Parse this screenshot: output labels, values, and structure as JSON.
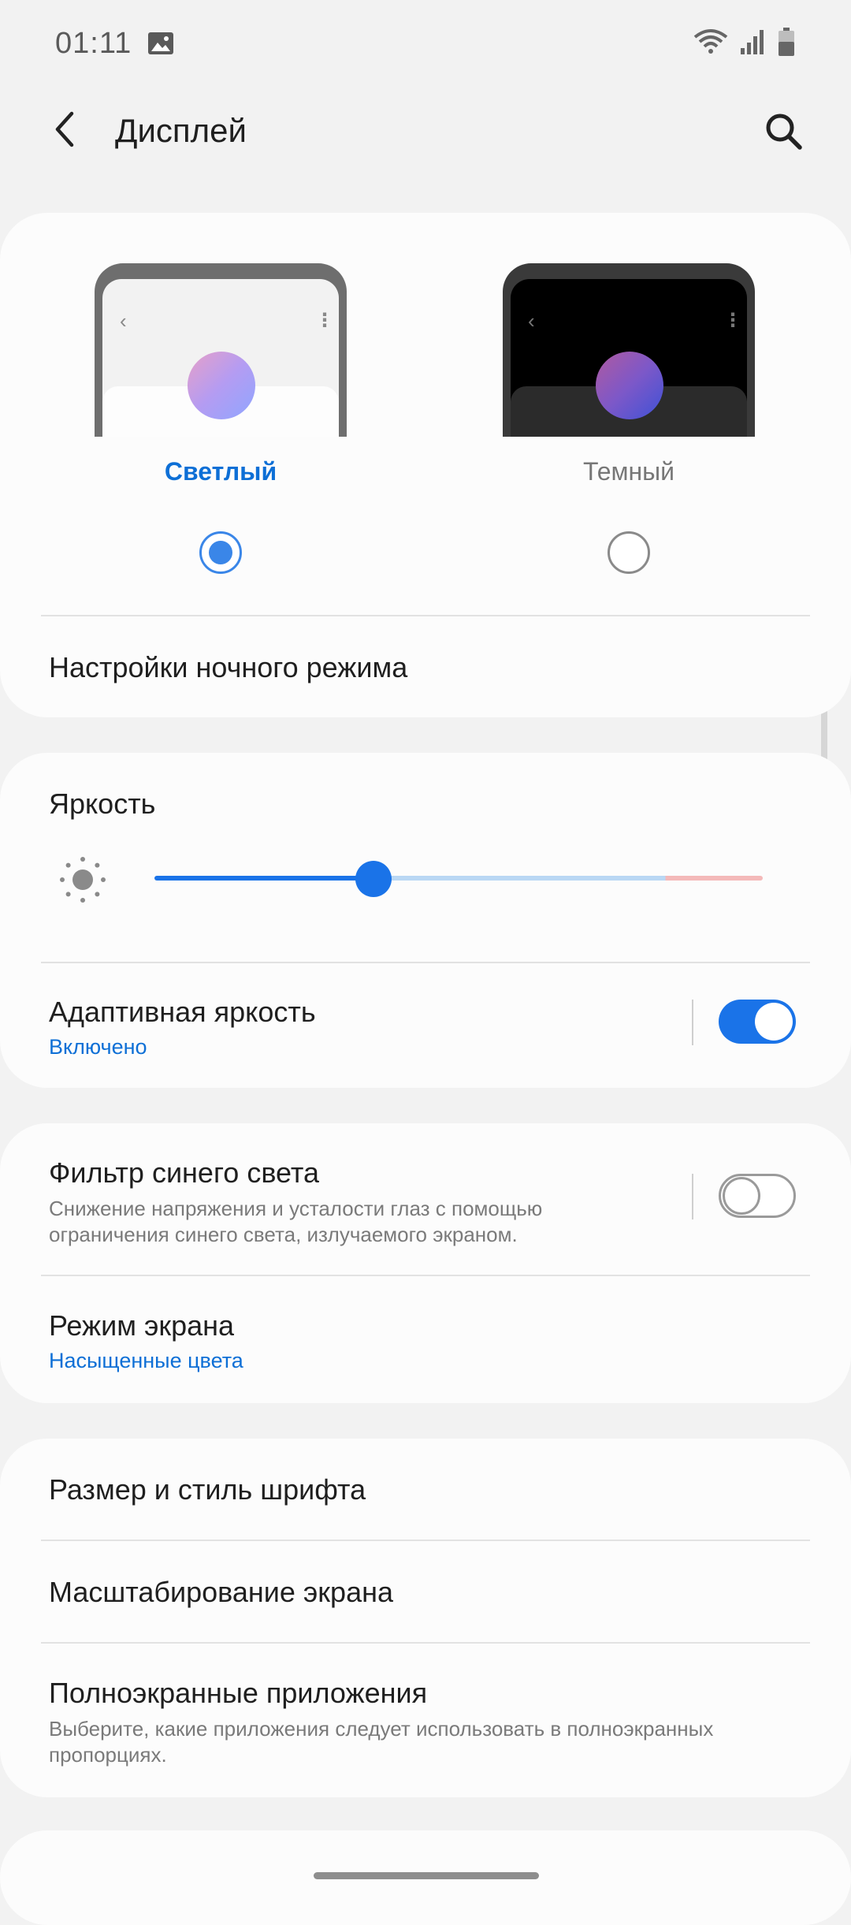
{
  "status_bar": {
    "time": "01:11",
    "icons": [
      "gallery-icon",
      "wifi-icon",
      "signal-icon",
      "battery-icon"
    ]
  },
  "app_bar": {
    "title": "Дисплей",
    "back_icon": "chevron-left-icon",
    "search_icon": "search-icon"
  },
  "theme": {
    "options": [
      {
        "label": "Светлый",
        "selected": true
      },
      {
        "label": "Темный",
        "selected": false
      }
    ],
    "night_settings_label": "Настройки ночного режима"
  },
  "brightness": {
    "title": "Яркость",
    "level": 0.36,
    "adaptive": {
      "title": "Адаптивная яркость",
      "status": "Включено",
      "enabled": true
    }
  },
  "blue_filter": {
    "title": "Фильтр синего света",
    "description": "Снижение напряжения и усталости глаз с помощью ограничения синего света, излучаемого экраном.",
    "enabled": false
  },
  "screen_mode": {
    "title": "Режим экрана",
    "value": "Насыщенные цвета"
  },
  "font_settings": {
    "font_size_style": "Размер и стиль шрифта",
    "screen_zoom": "Масштабирование экрана",
    "fullscreen_apps": {
      "title": "Полноэкранные приложения",
      "description": "Выберите, какие приложения следует использовать в полноэкранных пропорциях."
    }
  },
  "colors": {
    "accent": "#1a73e8",
    "selected_label": "#0d6fd6",
    "background": "#f2f2f2",
    "card": "#fcfcfc"
  }
}
